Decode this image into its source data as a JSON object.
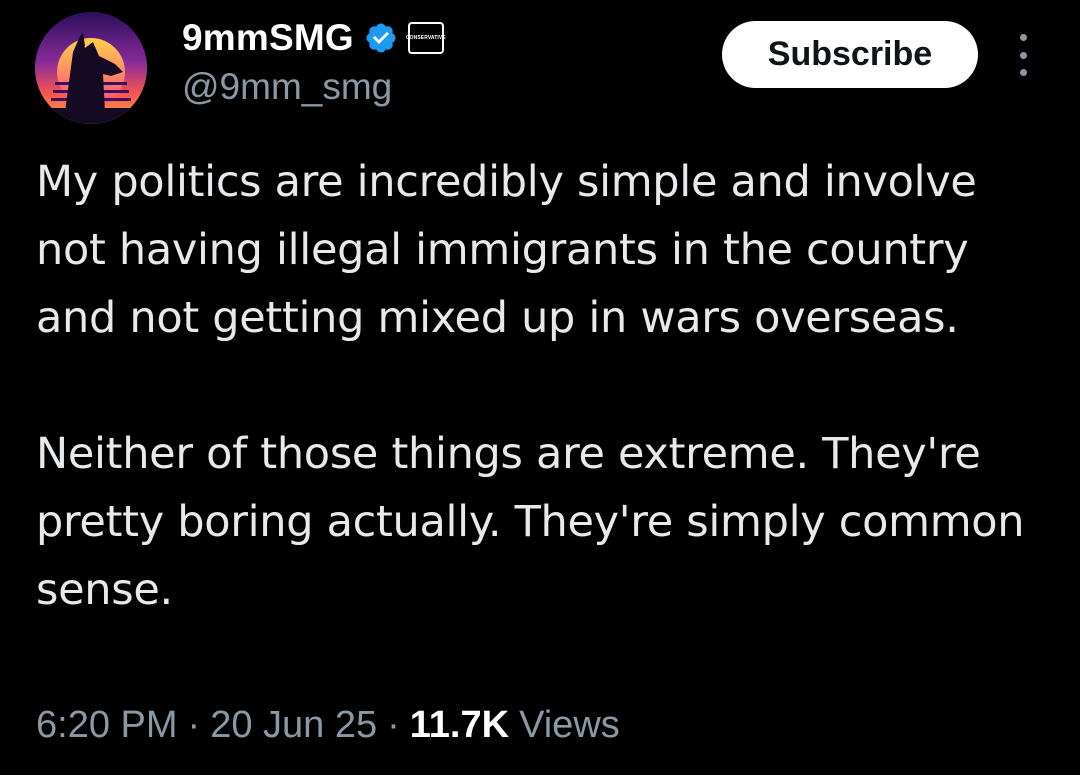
{
  "author": {
    "display_name": "9mmSMG",
    "handle": "@9mm_smg",
    "verified_icon": "verified-badge-icon",
    "affiliation_badge_text": "CONSERVATIVE",
    "avatar_icon": "dog-silhouette-sunset-icon"
  },
  "actions": {
    "subscribe_label": "Subscribe",
    "more_icon": "more-vertical-icon"
  },
  "tweet": {
    "paragraphs": [
      "My politics are incredibly simple and involve not having illegal immigrants in the country and not getting mixed up in wars overseas.",
      "Neither of those things are extreme. They're pretty boring actually. They're simply common sense."
    ]
  },
  "meta": {
    "time": "6:20 PM",
    "separator": "·",
    "date": "20 Jun 25",
    "views_count": "11.7K",
    "views_label": "Views"
  },
  "colors": {
    "background": "#000000",
    "text_primary": "#e7e9ea",
    "text_secondary": "#8b98a5",
    "verified_blue": "#1d9bf0",
    "button_bg": "#ffffff"
  }
}
